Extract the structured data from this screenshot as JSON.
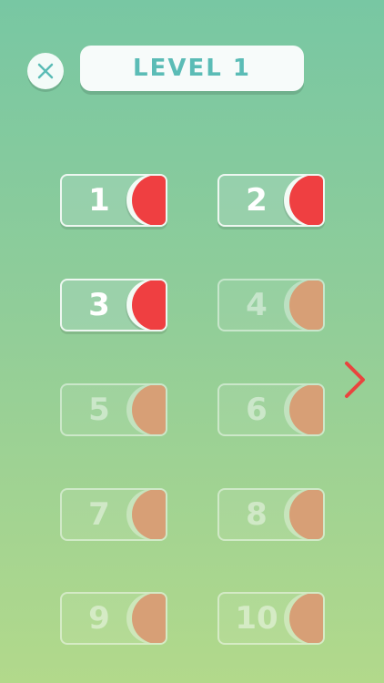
{
  "header": {
    "title": "LEVEL 1",
    "close_icon": "close-icon"
  },
  "levels": [
    {
      "number": "1",
      "status": "unlocked"
    },
    {
      "number": "2",
      "status": "unlocked"
    },
    {
      "number": "3",
      "status": "unlocked"
    },
    {
      "number": "4",
      "status": "locked"
    },
    {
      "number": "5",
      "status": "locked"
    },
    {
      "number": "6",
      "status": "locked"
    },
    {
      "number": "7",
      "status": "locked"
    },
    {
      "number": "8",
      "status": "locked"
    },
    {
      "number": "9",
      "status": "locked"
    },
    {
      "number": "10",
      "status": "locked"
    }
  ],
  "navigation": {
    "next_icon": "chevron-right-icon"
  },
  "colors": {
    "background_top": "#78c7a3",
    "background_bottom": "#b2d98b",
    "title_text": "#5bbcb6",
    "unlocked_indicator": "#ef3f41",
    "locked_indicator": "#d79f76",
    "next_arrow": "#e9443e"
  }
}
